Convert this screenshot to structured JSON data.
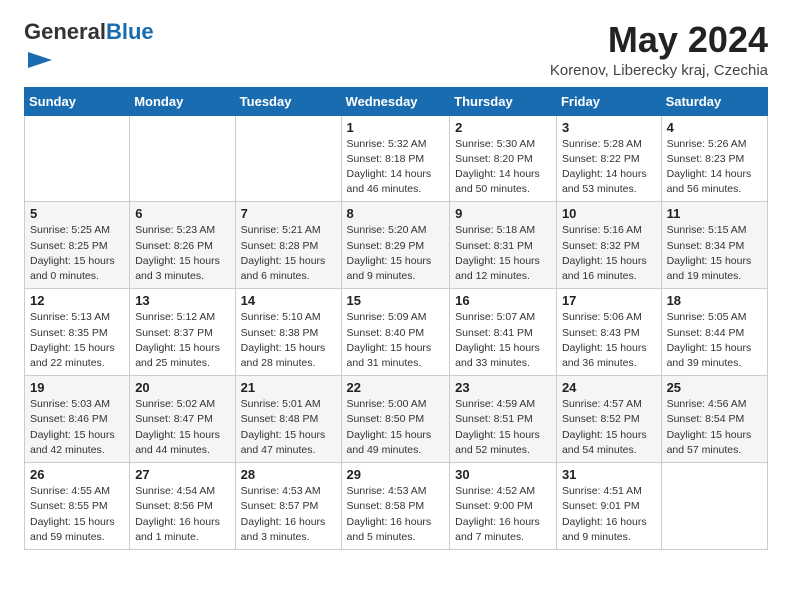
{
  "logo": {
    "general": "General",
    "blue": "Blue"
  },
  "header": {
    "month_year": "May 2024",
    "location": "Korenov, Liberecky kraj, Czechia"
  },
  "days_of_week": [
    "Sunday",
    "Monday",
    "Tuesday",
    "Wednesday",
    "Thursday",
    "Friday",
    "Saturday"
  ],
  "weeks": [
    [
      {
        "day": "",
        "info": ""
      },
      {
        "day": "",
        "info": ""
      },
      {
        "day": "",
        "info": ""
      },
      {
        "day": "1",
        "info": "Sunrise: 5:32 AM\nSunset: 8:18 PM\nDaylight: 14 hours\nand 46 minutes."
      },
      {
        "day": "2",
        "info": "Sunrise: 5:30 AM\nSunset: 8:20 PM\nDaylight: 14 hours\nand 50 minutes."
      },
      {
        "day": "3",
        "info": "Sunrise: 5:28 AM\nSunset: 8:22 PM\nDaylight: 14 hours\nand 53 minutes."
      },
      {
        "day": "4",
        "info": "Sunrise: 5:26 AM\nSunset: 8:23 PM\nDaylight: 14 hours\nand 56 minutes."
      }
    ],
    [
      {
        "day": "5",
        "info": "Sunrise: 5:25 AM\nSunset: 8:25 PM\nDaylight: 15 hours\nand 0 minutes."
      },
      {
        "day": "6",
        "info": "Sunrise: 5:23 AM\nSunset: 8:26 PM\nDaylight: 15 hours\nand 3 minutes."
      },
      {
        "day": "7",
        "info": "Sunrise: 5:21 AM\nSunset: 8:28 PM\nDaylight: 15 hours\nand 6 minutes."
      },
      {
        "day": "8",
        "info": "Sunrise: 5:20 AM\nSunset: 8:29 PM\nDaylight: 15 hours\nand 9 minutes."
      },
      {
        "day": "9",
        "info": "Sunrise: 5:18 AM\nSunset: 8:31 PM\nDaylight: 15 hours\nand 12 minutes."
      },
      {
        "day": "10",
        "info": "Sunrise: 5:16 AM\nSunset: 8:32 PM\nDaylight: 15 hours\nand 16 minutes."
      },
      {
        "day": "11",
        "info": "Sunrise: 5:15 AM\nSunset: 8:34 PM\nDaylight: 15 hours\nand 19 minutes."
      }
    ],
    [
      {
        "day": "12",
        "info": "Sunrise: 5:13 AM\nSunset: 8:35 PM\nDaylight: 15 hours\nand 22 minutes."
      },
      {
        "day": "13",
        "info": "Sunrise: 5:12 AM\nSunset: 8:37 PM\nDaylight: 15 hours\nand 25 minutes."
      },
      {
        "day": "14",
        "info": "Sunrise: 5:10 AM\nSunset: 8:38 PM\nDaylight: 15 hours\nand 28 minutes."
      },
      {
        "day": "15",
        "info": "Sunrise: 5:09 AM\nSunset: 8:40 PM\nDaylight: 15 hours\nand 31 minutes."
      },
      {
        "day": "16",
        "info": "Sunrise: 5:07 AM\nSunset: 8:41 PM\nDaylight: 15 hours\nand 33 minutes."
      },
      {
        "day": "17",
        "info": "Sunrise: 5:06 AM\nSunset: 8:43 PM\nDaylight: 15 hours\nand 36 minutes."
      },
      {
        "day": "18",
        "info": "Sunrise: 5:05 AM\nSunset: 8:44 PM\nDaylight: 15 hours\nand 39 minutes."
      }
    ],
    [
      {
        "day": "19",
        "info": "Sunrise: 5:03 AM\nSunset: 8:46 PM\nDaylight: 15 hours\nand 42 minutes."
      },
      {
        "day": "20",
        "info": "Sunrise: 5:02 AM\nSunset: 8:47 PM\nDaylight: 15 hours\nand 44 minutes."
      },
      {
        "day": "21",
        "info": "Sunrise: 5:01 AM\nSunset: 8:48 PM\nDaylight: 15 hours\nand 47 minutes."
      },
      {
        "day": "22",
        "info": "Sunrise: 5:00 AM\nSunset: 8:50 PM\nDaylight: 15 hours\nand 49 minutes."
      },
      {
        "day": "23",
        "info": "Sunrise: 4:59 AM\nSunset: 8:51 PM\nDaylight: 15 hours\nand 52 minutes."
      },
      {
        "day": "24",
        "info": "Sunrise: 4:57 AM\nSunset: 8:52 PM\nDaylight: 15 hours\nand 54 minutes."
      },
      {
        "day": "25",
        "info": "Sunrise: 4:56 AM\nSunset: 8:54 PM\nDaylight: 15 hours\nand 57 minutes."
      }
    ],
    [
      {
        "day": "26",
        "info": "Sunrise: 4:55 AM\nSunset: 8:55 PM\nDaylight: 15 hours\nand 59 minutes."
      },
      {
        "day": "27",
        "info": "Sunrise: 4:54 AM\nSunset: 8:56 PM\nDaylight: 16 hours\nand 1 minute."
      },
      {
        "day": "28",
        "info": "Sunrise: 4:53 AM\nSunset: 8:57 PM\nDaylight: 16 hours\nand 3 minutes."
      },
      {
        "day": "29",
        "info": "Sunrise: 4:53 AM\nSunset: 8:58 PM\nDaylight: 16 hours\nand 5 minutes."
      },
      {
        "day": "30",
        "info": "Sunrise: 4:52 AM\nSunset: 9:00 PM\nDaylight: 16 hours\nand 7 minutes."
      },
      {
        "day": "31",
        "info": "Sunrise: 4:51 AM\nSunset: 9:01 PM\nDaylight: 16 hours\nand 9 minutes."
      },
      {
        "day": "",
        "info": ""
      }
    ]
  ]
}
